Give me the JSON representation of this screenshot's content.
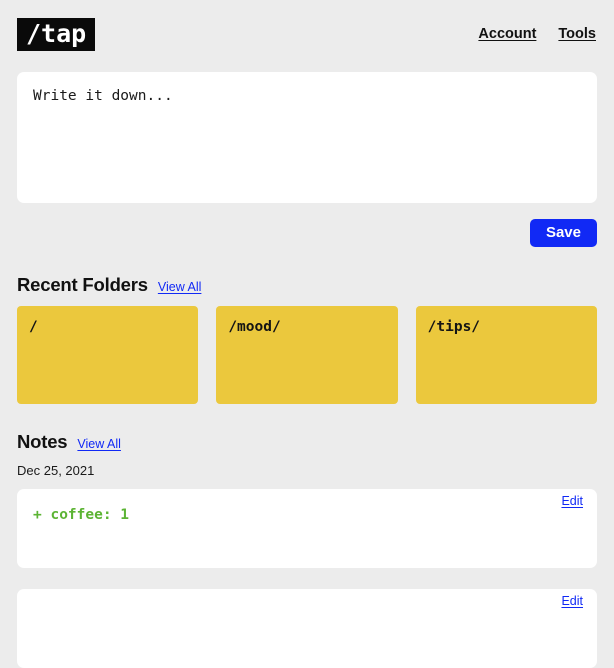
{
  "header": {
    "logo": "/tap",
    "nav": [
      {
        "label": "Account",
        "name": "nav-account"
      },
      {
        "label": "Tools",
        "name": "nav-tools"
      }
    ]
  },
  "composer": {
    "value": "",
    "placeholder": "Write it down..."
  },
  "actions": {
    "save_label": "Save"
  },
  "folders_section": {
    "title": "Recent Folders",
    "view_all_label": "View All",
    "items": [
      {
        "name": "/"
      },
      {
        "name": "/mood/"
      },
      {
        "name": "/tips/"
      }
    ]
  },
  "notes_section": {
    "title": "Notes",
    "view_all_label": "View All",
    "date": "Dec 25, 2021",
    "edit_label": "Edit",
    "items": [
      {
        "body": "+ coffee: 1",
        "edit_label": "Edit"
      },
      {
        "body": "",
        "edit_label": "Edit"
      }
    ]
  },
  "colors": {
    "background": "#ececec",
    "accent_blue": "#1129f5",
    "folder_yellow": "#ebc83d",
    "note_green": "#5cb434",
    "logo_black": "#0a0a0a"
  }
}
